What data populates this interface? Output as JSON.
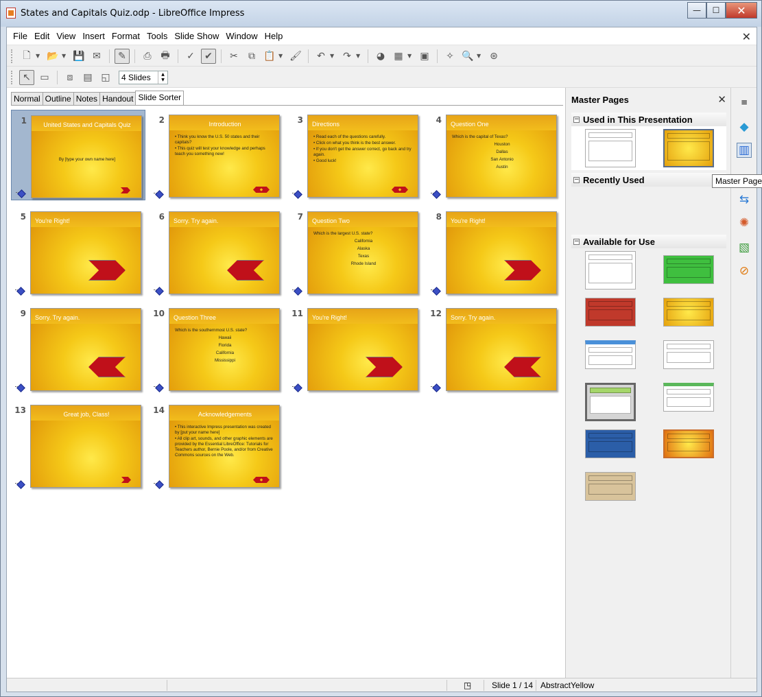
{
  "window": {
    "title": "States and Capitals Quiz.odp - LibreOffice Impress",
    "minimize": "—",
    "maximize": "☐",
    "close": "✕"
  },
  "menu": [
    "File",
    "Edit",
    "View",
    "Insert",
    "Format",
    "Tools",
    "Slide Show",
    "Window",
    "Help"
  ],
  "menu_close": "✕",
  "slide_count_field": "4 Slides",
  "view_tabs": [
    "Normal",
    "Outline",
    "Notes",
    "Handout",
    "Slide Sorter"
  ],
  "active_tab": "Slide Sorter",
  "slides": [
    {
      "num": "1",
      "title": "United States and Capitals Quiz",
      "body": [
        "By [type your own name here]"
      ],
      "center": true
    },
    {
      "num": "2",
      "title": "Introduction",
      "bullets": [
        "Think you know the U.S. 50 states and their capitals?",
        "This quiz will test your knowledge and perhaps teach you something new!"
      ]
    },
    {
      "num": "3",
      "title": "Directions",
      "bullets": [
        "Read each of the questions carefully.",
        "Click on what you think is the best answer.",
        "If you don't get the answer correct, go back and try again.",
        "Good luck!"
      ]
    },
    {
      "num": "4",
      "title": "Question One",
      "question": "Which is the capital of Texas?",
      "options": [
        "Houston",
        "Dallas",
        "San Antonio",
        "Austin"
      ]
    },
    {
      "num": "5",
      "title": "You're Right!"
    },
    {
      "num": "6",
      "title": "Sorry. Try again."
    },
    {
      "num": "7",
      "title": "Question Two",
      "question": "Which is the largest U.S. state?",
      "options": [
        "California",
        "Alaska",
        "Texas",
        "Rhode Island"
      ]
    },
    {
      "num": "8",
      "title": "You're Right!"
    },
    {
      "num": "9",
      "title": "Sorry. Try again."
    },
    {
      "num": "10",
      "title": "Question Three",
      "question": "Which is the southernmost U.S. state?",
      "options": [
        "Hawaii",
        "Florida",
        "California",
        "Mississippi"
      ]
    },
    {
      "num": "11",
      "title": "You're Right!"
    },
    {
      "num": "12",
      "title": "Sorry. Try again."
    },
    {
      "num": "13",
      "title": "Great job, Class!"
    },
    {
      "num": "14",
      "title": "Acknowledgements",
      "bullets": [
        "This interactive Impress presentation was created by [put your name here]",
        "All clip art, sounds, and other graphic elements are provided by the Essential LibreOffice: Tutorials for Teachers author, Bernie Poole, and/or from Creative Commons sources on the Web."
      ]
    }
  ],
  "side_panel": {
    "title": "Master Pages",
    "close": "✕",
    "sections": {
      "used": "Used in This Presentation",
      "recent": "Recently Used",
      "available": "Available for Use"
    }
  },
  "tooltip": "Master Pages",
  "status": {
    "slide": "Slide 1 / 14",
    "master": "AbstractYellow"
  }
}
